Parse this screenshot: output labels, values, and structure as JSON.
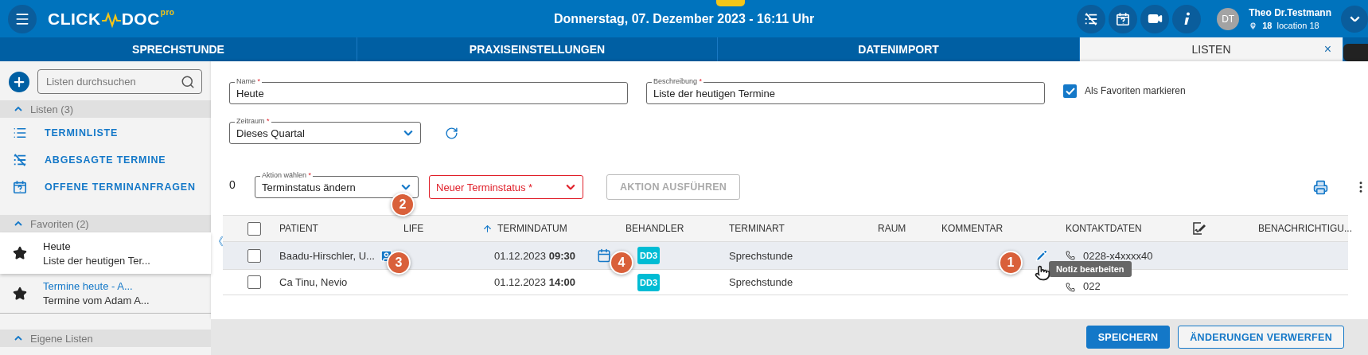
{
  "header": {
    "logo": {
      "left": "CLICK",
      "right": "DOC",
      "suffix": "pro"
    },
    "date": "Donnerstag, 07. Dezember 2023 - 16:11 Uhr",
    "user": {
      "initials": "DT",
      "name": "Theo Dr.Testmann",
      "location_number": "18",
      "location": "location 18"
    }
  },
  "tabs": [
    {
      "label": "SPRECHSTUNDE",
      "selected": false
    },
    {
      "label": "PRAXISEINSTELLUNGEN",
      "selected": false
    },
    {
      "label": "DATENIMPORT",
      "selected": false
    },
    {
      "label": "LISTEN",
      "selected": true,
      "close": "×"
    }
  ],
  "sidebar": {
    "search": {
      "placeholder": "Listen durchsuchen"
    },
    "sections": [
      {
        "title": "Listen (3)",
        "expanded": true,
        "items": [
          {
            "kind": "list",
            "label": "TERMINLISTE"
          },
          {
            "kind": "cancelled",
            "label": "ABGESAGTE TERMINE"
          },
          {
            "kind": "requests",
            "label": "OFFENE TERMINANFRAGEN"
          }
        ]
      },
      {
        "title": "Favoriten (2)",
        "expanded": true,
        "favorites": [
          {
            "title": "Heute",
            "subtitle": "Liste der heutigen Ter...",
            "selected": true
          },
          {
            "title": "Termine heute - A...",
            "subtitle": "Termine vom Adam A...",
            "selected": false
          }
        ]
      },
      {
        "title": "Eigene Listen",
        "expanded": true
      }
    ],
    "collapse": "《"
  },
  "form": {
    "name": {
      "label": "Name",
      "required": "*",
      "value": "Heute"
    },
    "description": {
      "label": "Beschreibung",
      "required": "*",
      "value": "Liste der heutigen Termine"
    },
    "favorite": {
      "label": "Als Favoriten markieren",
      "checked": true
    },
    "period": {
      "label": "Zeitraum",
      "required": "*",
      "value": "Dieses Quartal"
    }
  },
  "actions": {
    "count": "0",
    "action": {
      "label": "Aktion wählen",
      "required": "*",
      "value": "Terminstatus ändern"
    },
    "new_status": {
      "placeholder": "Neuer Terminstatus *",
      "error": true
    },
    "execute": {
      "label": "AKTION AUSFÜHREN",
      "disabled": true
    }
  },
  "table": {
    "columns": [
      {
        "kind": "check",
        "checked": false
      },
      {
        "kind": "text",
        "label": "PATIENT",
        "sorted": false
      },
      {
        "kind": "text",
        "label": "LIFE",
        "sorted": false
      },
      {
        "kind": "text",
        "label": "TERMINDATUM",
        "sorted": true
      },
      {
        "kind": "text",
        "label": "BEHANDLER",
        "sorted": false
      },
      {
        "kind": "text",
        "label": "TERMINART",
        "sorted": false
      },
      {
        "kind": "text",
        "label": "RAUM",
        "sorted": false
      },
      {
        "kind": "text",
        "label": "KOMMENTAR",
        "sorted": false
      },
      {
        "kind": "text",
        "label": "KONTAKTDATEN",
        "sorted": false
      },
      {
        "kind": "icon"
      },
      {
        "kind": "text",
        "label": "BENACHRICHTIGU..."
      }
    ],
    "rows": [
      {
        "checked": false,
        "hovered": true,
        "patient": "Baadu-Hirschler, U...",
        "contact_card": true,
        "date": "01.12.2023 **09:30**",
        "calendar": true,
        "behandler": "DD3",
        "terminart": "Sprechstunde",
        "note_edit": true,
        "phone": "0228-x4xxxx40"
      },
      {
        "checked": false,
        "hovered": false,
        "patient": "Ca Tinu, Nevio",
        "contact_card": false,
        "date": "01.12.2023 **14:00**",
        "calendar": false,
        "behandler": "DD3",
        "terminart": "Sprechstunde",
        "note_edit": false,
        "phone": "022"
      }
    ]
  },
  "tooltip": "Notiz bearbeiten",
  "markers": [
    {
      "label": "2"
    },
    {
      "label": "3"
    },
    {
      "label": "4"
    },
    {
      "label": "1"
    }
  ],
  "footer": {
    "buttons": [
      {
        "kind": "primary",
        "label": "SPEICHERN"
      },
      {
        "kind": "secondary",
        "label": "ÄNDERUNGEN VERWERFEN"
      }
    ]
  }
}
